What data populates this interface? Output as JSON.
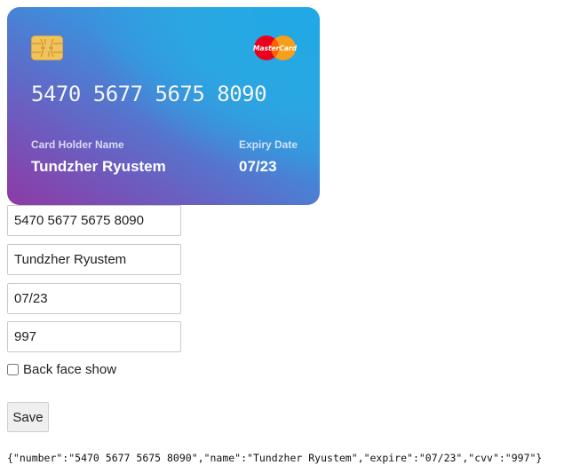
{
  "card": {
    "number": "5470 5677 5675 8090",
    "holder_label": "Card Holder Name",
    "holder_name": "Tundzher Ryustem",
    "expiry_label": "Expiry Date",
    "expiry": "07/23",
    "brand": "MasterCard",
    "colors": {
      "gradient_start": "#26a8e4",
      "gradient_end": "#8e3aa5",
      "chip": "#f2c35c",
      "brand_red": "#eb001b",
      "brand_orange": "#f79e1b"
    }
  },
  "form": {
    "number_value": "5470 5677 5675 8090",
    "name_value": "Tundzher Ryustem",
    "expire_value": "07/23",
    "cvv_value": "997",
    "back_face_label": "Back face show",
    "back_face_checked": false,
    "save_label": "Save"
  },
  "output": {
    "json_text": "{\"number\":\"5470 5677 5675 8090\",\"name\":\"Tundzher Ryustem\",\"expire\":\"07/23\",\"cvv\":\"997\"}"
  }
}
